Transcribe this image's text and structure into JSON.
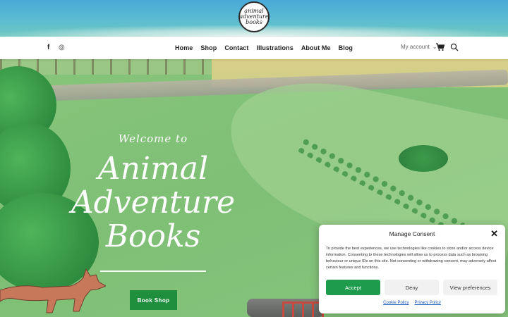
{
  "header": {
    "logo_lines": [
      "animal",
      "adventure",
      "books"
    ]
  },
  "nav": {
    "social": [
      {
        "icon": "facebook-icon",
        "glyph": "f"
      },
      {
        "icon": "instagram-icon",
        "glyph": "◎"
      }
    ],
    "menu": [
      "Home",
      "Shop",
      "Contact",
      "Illustrations",
      "About Me",
      "Blog"
    ],
    "account_label": "My account",
    "account_chevron": "⌄"
  },
  "hero": {
    "welcome": "Welcome to",
    "title_lines": [
      "Animal",
      "Adventure",
      "Books"
    ],
    "button_label": "Book Shop"
  },
  "consent": {
    "title": "Manage Consent",
    "close_glyph": "✕",
    "body": "To provide the best experiences, we use technologies like cookies to store and/or access device information. Consenting to these technologies will allow us to process data such as browsing behaviour or unique IDs on this site. Not consenting or withdrawing consent, may adversely affect certain features and functions.",
    "accept_label": "Accept",
    "deny_label": "Deny",
    "preferences_label": "View preferences",
    "cookie_policy_label": "Cookie Policy",
    "privacy_policy_label": "Privacy Policy"
  },
  "colors": {
    "accent_green": "#1e8f3c",
    "accept_green": "#1e9b4c",
    "link_blue": "#1d5bbf"
  }
}
